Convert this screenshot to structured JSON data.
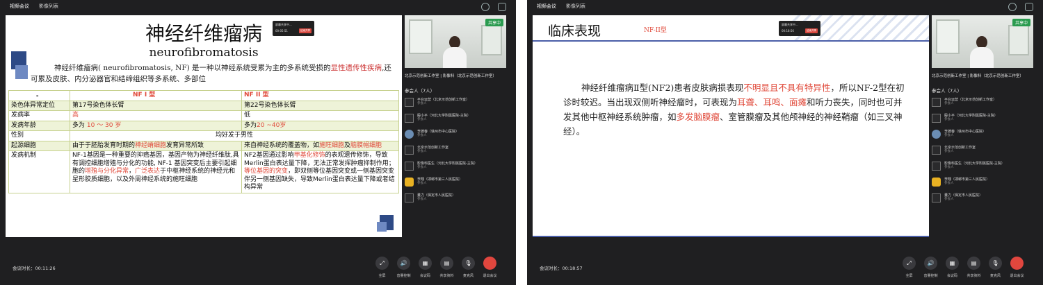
{
  "panels": [
    {
      "tabs": [
        "视频会议",
        "影像列表"
      ],
      "popup": {
        "line1": "屏幕共享中...",
        "line2": "00:05:51",
        "button": "结束共享"
      },
      "slide": {
        "title": "神经纤维瘤病",
        "subtitle": "neurofibromatosis",
        "intro_parts": [
          "神经纤维瘤病( neurofibromatosis, NF) 是一种以神经系统受累为主的多系统受损的",
          "显性遗传性疾病",
          ",还可累及皮肤、内分泌器官和结缔组织等多系统、多部位"
        ],
        "table": {
          "header": [
            "。",
            "NF I 型",
            "NF II 型"
          ],
          "rows": [
            {
              "label": "染色体异常定位",
              "nf1": "第17号染色体长臂",
              "nf2": "第22号染色体长臂"
            },
            {
              "label": "发病率",
              "nf1": "高",
              "nf2": "低"
            },
            {
              "label": "发病年龄",
              "nf1_pre": "多为 ",
              "nf1_red": "10 ～ 30 岁",
              "nf2_pre": "多为",
              "nf2_red": "20 ~40岁"
            },
            {
              "label": "性别",
              "merged": "均好发于男性"
            },
            {
              "label": "起源细胞",
              "nf1_parts": [
                "由于于胚胎发育时期的",
                "神经嵴细胞",
                "发育异常所致"
              ],
              "nf2_parts": [
                "来自神经系统的覆盖物，如",
                "施旺细胞",
                "及",
                "脑膜帽细胞"
              ]
            },
            {
              "label": "发病机制",
              "nf1_parts": [
                "NF-1基因是一种重要的抑癌基因，基因产物为神经纤维肽,具有调控细胞增殖与分化的功能, NF-1 基因突变后主要引起细胞的",
                "增殖与分化异常",
                "，",
                "广泛表达",
                "于中枢神经系统的神经元和星形胶质细胞，以及外周神经系统的施旺细胞"
              ],
              "nf2_parts": [
                "NF2基因通过影响",
                "甲基化修饰",
                "的表观遗传修饰，导致Merlin蛋白表达量下降，无法正常发挥肿瘤抑制作用；",
                "等位基因的突变",
                "，即双侧等位基因突变或一侧基因突变伴另一侧基因缺失，导致Merlin蛋白表达量下降或者结构异常"
              ]
            }
          ]
        }
      },
      "video_caption": "北京示范创新工作室 | 影像科（北京示范创新工作室）",
      "participants_header": "参会人（7人）",
      "participants": [
        {
          "name": "平台运营（北京示范创新工作室）",
          "role": "参会人",
          "avatar": "blank"
        },
        {
          "name": "殷小平（河北大学附属医院-主院）",
          "role": "参会人",
          "avatar": "blank"
        },
        {
          "name": "李德春（徐州市中心医院）",
          "role": "参会人",
          "avatar": "photo"
        },
        {
          "name": "北京示范创新工作室",
          "role": "参会人",
          "avatar": "blank"
        },
        {
          "name": "影像科医生（河北大学附属医院-主院）",
          "role": "参会人",
          "avatar": "blank"
        },
        {
          "name": "李翔（邯郸市第三人民医院）",
          "role": "参会人",
          "avatar": "yellow"
        },
        {
          "name": "董力（保定市人民医院）",
          "role": "参会人",
          "avatar": "blank"
        }
      ],
      "timer_label": "会议时长：",
      "timer_value": "00:11:26",
      "controls": [
        "全屏",
        "音量控制",
        "会议码",
        "共享资料",
        "麦克风",
        "退出会议"
      ]
    },
    {
      "tabs": [
        "视频会议",
        "影像列表"
      ],
      "popup": {
        "line1": "屏幕共享中...",
        "line2": "00:18:56",
        "button": "结束共享"
      },
      "slide": {
        "title": "临床表现",
        "tag": "NF-II型",
        "body_parts": [
          "神经纤维瘤病Ⅱ型(NF2)患者皮肤病损表现",
          "不明显且不具有特异性",
          "，所以NF-2型在初诊时较迟。当出现双侧听神经瘤时，可表现为",
          "耳聋、耳鸣、面瘫",
          "和听力丧失，同时也可并发其他中枢神经系统肿瘤，如",
          "多发脑膜瘤",
          "、室管膜瘤及其他颅神经的神经鞘瘤（如三叉神经）。"
        ]
      },
      "video_caption": "北京示范创新工作室 | 影像科（北京示范创新工作室）",
      "participants_header": "参会人（7人）",
      "participants": [
        {
          "name": "平台运营（北京示范创新工作室）",
          "role": "参会人",
          "avatar": "blank"
        },
        {
          "name": "殷小平（河北大学附属医院-主院）",
          "role": "参会人",
          "avatar": "blank"
        },
        {
          "name": "李德春（徐州市中心医院）",
          "role": "参会人",
          "avatar": "photo"
        },
        {
          "name": "北京示范创新工作室",
          "role": "参会人",
          "avatar": "blank"
        },
        {
          "name": "影像科医生（河北大学附属医院-主院）",
          "role": "参会人",
          "avatar": "blank"
        },
        {
          "name": "李翔（邯郸市第三人民医院）",
          "role": "参会人",
          "avatar": "yellow"
        },
        {
          "name": "董力（保定市人民医院）",
          "role": "参会人",
          "avatar": "blank"
        }
      ],
      "timer_label": "会议时长：",
      "timer_value": "00:18:57",
      "controls": [
        "全屏",
        "音量控制",
        "会议码",
        "共享资料",
        "麦克风",
        "退出会议"
      ]
    }
  ],
  "colors": {
    "accent_red": "#e0493a",
    "panel_bg": "#1f1f21",
    "badge_green": "#2a9b4f",
    "table_border": "#c6d18e"
  },
  "badge": "共享中",
  "icons": {
    "controls": [
      "expand-icon",
      "speaker-icon",
      "qr-code-icon",
      "document-icon",
      "microphone-icon",
      "hangup-icon"
    ]
  }
}
